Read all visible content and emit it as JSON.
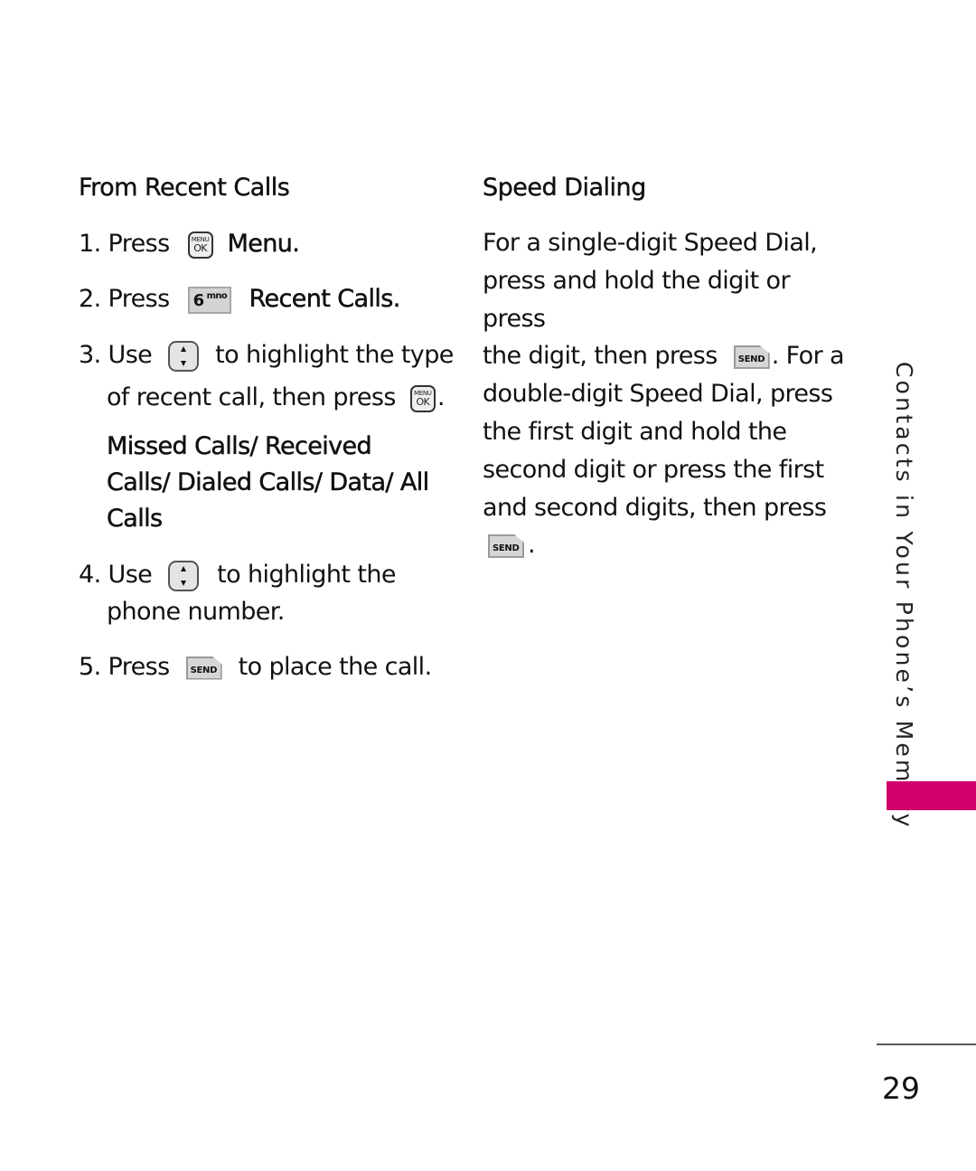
{
  "left_section": {
    "heading": "From Recent Calls",
    "steps": [
      {
        "num": "1.",
        "before": "Press",
        "key": "menu-ok-key",
        "after": "Menu."
      },
      {
        "num": "2.",
        "before": "Press",
        "key": "6-mno-key",
        "after": "Recent Calls."
      },
      {
        "num": "3.",
        "before": "Use",
        "key": "nav-key",
        "after": "to highlight the type",
        "line2": "of recent call, then press",
        "key2": "menu-ok-key",
        "line2_end": ".",
        "options_line1": "Missed Calls/ Received",
        "options_line2": "Calls/ Dialed Calls/ Data/ All",
        "options_line3": "Calls"
      },
      {
        "num": "4.",
        "before": "Use",
        "key": "nav-key",
        "after": "to highlight the",
        "line2": "phone number."
      },
      {
        "num": "5.",
        "before": "Press",
        "key": "send-key",
        "after": "to place the call."
      }
    ]
  },
  "right_section": {
    "heading": "Speed Dialing",
    "lines": [
      "For a single-digit Speed Dial,",
      "press and hold the digit or press",
      "the digit, then press",
      ". For a",
      "double-digit Speed Dial, press",
      "the first digit and hold the",
      "second digit or press the first",
      "and second digits, then press",
      "."
    ]
  },
  "keys": {
    "menu_top": "MENU",
    "menu_bottom": "OK",
    "six_digit": "6",
    "six_letters": "mno",
    "send": "SEND"
  },
  "side_tab": {
    "label": "Contacts in Your Phone’s Memory",
    "color": "#d1006b"
  },
  "page_number": "29"
}
